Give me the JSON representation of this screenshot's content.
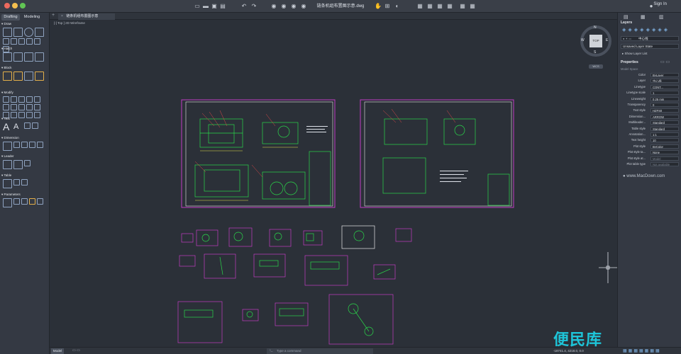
{
  "window": {
    "title": "链条机组布置图示意.dwg",
    "sign_in": "Sign In"
  },
  "left_panel": {
    "tabs": [
      "Drafting",
      "Modeling"
    ],
    "sections": [
      "Draw",
      "Hatch",
      "Block",
      "Modify",
      "Text",
      "Dimension",
      "Leader",
      "Table",
      "Parameters"
    ]
  },
  "document": {
    "tab": "链条机组布置图示意",
    "view_label": "[-] Top ] 2D Wireframe"
  },
  "viewcube": {
    "face": "TOP",
    "N": "N",
    "S": "S",
    "E": "E",
    "W": "W",
    "wcs": "WCS"
  },
  "layers": {
    "title": "Layers",
    "current": "中心线",
    "state": "Unsaved Layer State",
    "show_list": "Show Layer List"
  },
  "properties": {
    "title": "Properties",
    "scope": "Model Space",
    "rows": [
      {
        "label": "Color",
        "value": "ByLayer"
      },
      {
        "label": "Layer",
        "value": "中心线"
      },
      {
        "label": "Linetype",
        "value": "CONT..."
      },
      {
        "label": "Linetype scale",
        "value": "1"
      },
      {
        "label": "Lineweight",
        "value": "0.25 mm"
      },
      {
        "label": "Transparency",
        "value": "0"
      },
      {
        "label": "Text style",
        "value": "HZFS0"
      },
      {
        "label": "Dimension...",
        "value": "ARROW"
      },
      {
        "label": "Multileader...",
        "value": "Standard"
      },
      {
        "label": "Table style",
        "value": "Standard"
      },
      {
        "label": "Annotation...",
        "value": "1:1"
      },
      {
        "label": "Text height",
        "value": "10"
      },
      {
        "label": "Plot style",
        "value": "ByColor"
      },
      {
        "label": "Plot style ta...",
        "value": "None"
      },
      {
        "label": "Plot style at...",
        "value": "Model"
      },
      {
        "label": "Plot table type",
        "value": "Not available"
      }
    ]
  },
  "status": {
    "model_tab": "Model",
    "command_placeholder": "Type a command",
    "coords": "-18741.4, 4218.0, 0.0"
  },
  "watermarks": {
    "site": "www.MacDown.com",
    "brand": "便民库"
  },
  "colors": {
    "accent": "#c23bc4",
    "drawing_green": "#2bd84a",
    "drawing_yellow": "#e4e04a",
    "drawing_red": "#e04848",
    "background": "#2b3038"
  }
}
